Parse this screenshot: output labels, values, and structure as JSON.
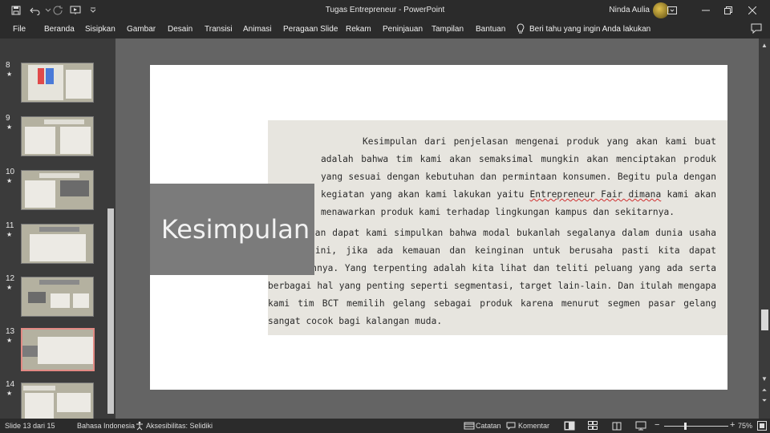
{
  "window": {
    "title": "Tugas Entrepreneur  -  PowerPoint",
    "user_name": "Ninda Aulia"
  },
  "ribbon": {
    "tabs": [
      "File",
      "Beranda",
      "Sisipkan",
      "Gambar",
      "Desain",
      "Transisi",
      "Animasi",
      "Peragaan Slide",
      "Rekam",
      "Peninjauan",
      "Tampilan",
      "Bantuan"
    ],
    "tell_me": "Beri tahu yang ingin Anda lakukan"
  },
  "thumbnails": [
    {
      "number": "8",
      "star": "★"
    },
    {
      "number": "9",
      "star": "★"
    },
    {
      "number": "10",
      "star": "★"
    },
    {
      "number": "11",
      "star": "★"
    },
    {
      "number": "12",
      "star": "★"
    },
    {
      "number": "13",
      "star": "★",
      "active": true
    },
    {
      "number": "14",
      "star": "★"
    }
  ],
  "slide": {
    "title": "Kesimpulan",
    "paragraph1_a": "Kesimpulan dari penjelasan mengenai produk yang akan kami buat adalah bahwa tim kami akan semaksimal mungkin akan menciptakan produk yang sesuai dengan kebutuhan dan permintaan konsumen. Begitu pula dengan kegiatan yang akan kami lakukan yaitu ",
    "paragraph1_link": "Entrepreneur Fair dimana",
    "paragraph1_b": " kami akan menawarkan produk kami terhadap lingkungan kampus dan sekitarnya.",
    "paragraph2": "Dan dapat kami simpulkan bahwa modal bukanlah segalanya dalam dunia usaha seperti ini, jika ada kemauan dan keinginan untuk berusaha pasti kita dapat melakukannya. Yang terpenting adalah kita lihat dan teliti peluang yang ada serta berbagai hal yang penting seperti segmentasi, target lain-lain. Dan itulah mengapa kami tim BCT memilih gelang sebagai produk karena menurut segmen pasar gelang sangat cocok bagi kalangan muda."
  },
  "statusbar": {
    "slide_info": "Slide 13 dari 15",
    "language": "Bahasa Indonesia",
    "accessibility": "Aksesibilitas: Selidiki",
    "notes": "Catatan",
    "comments": "Komentar",
    "zoom": "75%"
  },
  "colors": {
    "slide_bg": "#b4b1a0",
    "content_box": "#e7e5df",
    "title_block": "#7b7b7b",
    "active_thumb_border": "#e38a84"
  }
}
